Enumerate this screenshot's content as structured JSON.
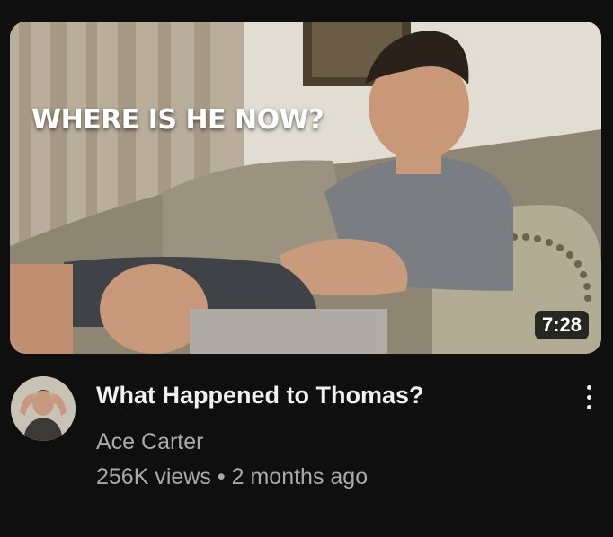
{
  "video": {
    "thumbnail_overlay_text": "WHERE IS HE NOW?",
    "duration": "7:28",
    "title": "What Happened to Thomas?",
    "channel": "Ace Carter",
    "views": "256K views",
    "separator": "•",
    "age": "2 months ago"
  },
  "icons": {
    "more": "vertical-ellipsis-icon"
  },
  "colors": {
    "background": "#0f0f0f",
    "title_text": "#f1f1f1",
    "secondary_text": "#aaaaaa"
  }
}
